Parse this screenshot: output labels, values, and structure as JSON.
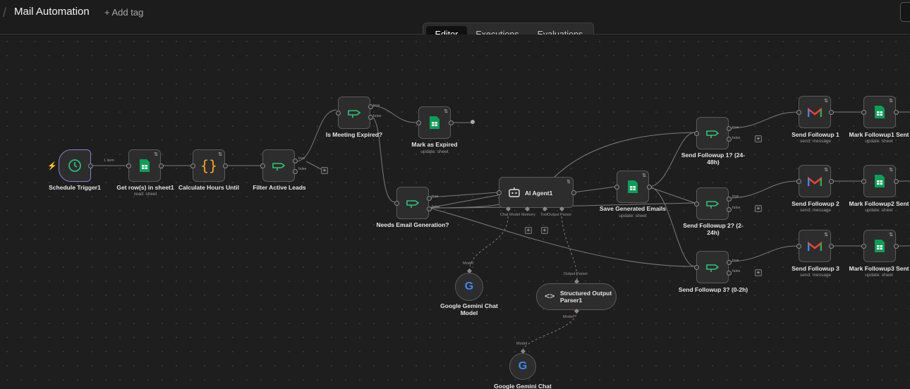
{
  "header": {
    "title": "Mail Automation",
    "add_tag": "+ Add tag"
  },
  "tabs": [
    {
      "label": "Editor",
      "active": true
    },
    {
      "label": "Executions",
      "active": false
    },
    {
      "label": "Evaluations",
      "active": false
    }
  ],
  "colors": {
    "background": "#1e1e1e",
    "node": "#2d2d2d",
    "trigger_border": "#8d7bd6",
    "sheets_green": "#0f9d58",
    "clock_green": "#2fb87c",
    "code_orange": "#f5a623",
    "filter_green": "#35c07a",
    "gmail_red": "#ea4335"
  },
  "nodes": {
    "schedule": {
      "label": "Schedule Trigger1",
      "edge_label": "1 item",
      "icon": "clock-icon"
    },
    "get_rows": {
      "label": "Get row(s) in sheet1",
      "sub": "read: sheet",
      "icon": "sheets-icon"
    },
    "calc": {
      "label": "Calculate Hours Until",
      "icon": "code-braces-icon"
    },
    "filter": {
      "label": "Filter Active Leads",
      "icon": "filter-icon",
      "out_true": "true",
      "out_false": "false"
    },
    "is_expired": {
      "label": "Is Meeting Expired?",
      "icon": "filter-icon",
      "out_true": "true",
      "out_false": "false"
    },
    "mark_expired": {
      "label": "Mark as Expired",
      "sub": "update: sheet",
      "icon": "sheets-icon"
    },
    "needs_email": {
      "label": "Needs Email Generation?",
      "icon": "filter-icon",
      "out_true": "true",
      "out_false": "false"
    },
    "agent": {
      "label": "AI Agent1",
      "icon": "robot-icon",
      "ports": [
        "Chat Model",
        "Memory",
        "Tool",
        "Output Parser"
      ]
    },
    "save_emails": {
      "label": "Save Generated Emails",
      "sub": "update: sheet",
      "icon": "sheets-icon"
    },
    "gemini1": {
      "label": "Google Gemini Chat Model",
      "port": "Model",
      "icon": "google-icon"
    },
    "parser": {
      "label": "Structured Output Parser1",
      "port_top": "Output Parser",
      "port_bottom": "Model",
      "icon": "code-icon"
    },
    "gemini2": {
      "label": "Google Gemini Chat",
      "port": "Model",
      "icon": "google-icon"
    },
    "fu1_check": {
      "label": "Send Followup 1? (24-48h)",
      "out_true": "true",
      "out_false": "false"
    },
    "fu2_check": {
      "label": "Send Followup 2? (2-24h)",
      "out_true": "true",
      "out_false": "false"
    },
    "fu3_check": {
      "label": "Send Followup 3? (0-2h)",
      "out_true": "true",
      "out_false": "false"
    },
    "send1": {
      "label": "Send Followup 1",
      "sub": "send: message",
      "icon": "gmail-icon"
    },
    "send2": {
      "label": "Send Followup 2",
      "sub": "send: message",
      "icon": "gmail-icon"
    },
    "send3": {
      "label": "Send Followup 3",
      "sub": "send: message",
      "icon": "gmail-icon"
    },
    "mark1": {
      "label": "Mark Followup1 Sent",
      "sub": "update: sheet",
      "icon": "sheets-icon"
    },
    "mark2": {
      "label": "Mark Followup2 Sent",
      "sub": "update: sheet",
      "icon": "sheets-icon"
    },
    "mark3": {
      "label": "Mark Followup3 Sent",
      "sub": "update: sheet",
      "icon": "sheets-icon"
    }
  }
}
